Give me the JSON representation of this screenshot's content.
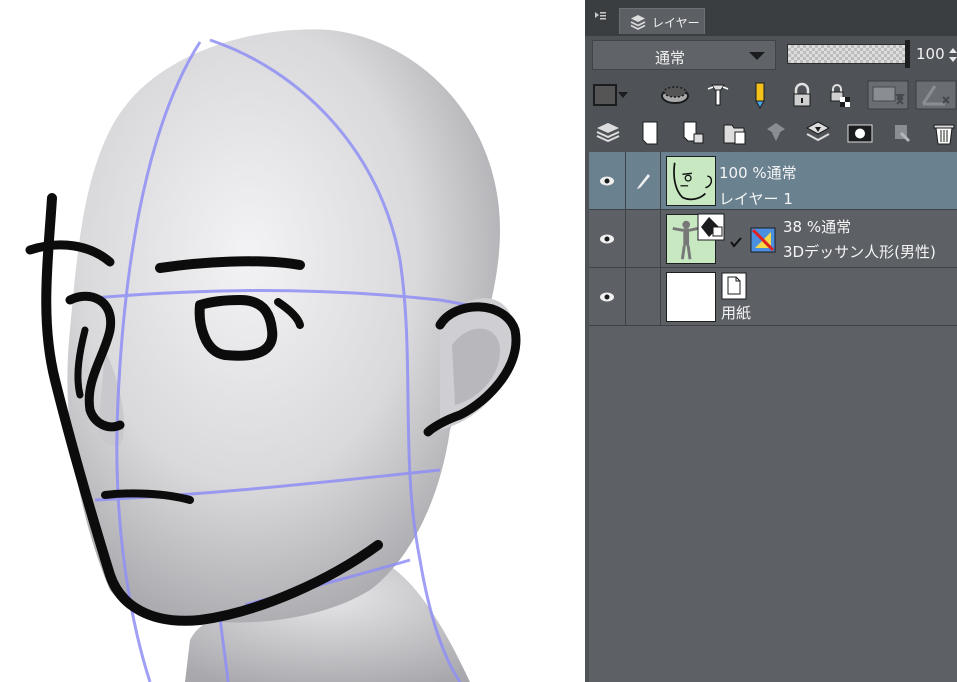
{
  "panel": {
    "tab_label": "レイヤー",
    "blend_mode": "通常",
    "opacity_value": "100",
    "opacity_fraction": 1.0
  },
  "toolbar_row1": [
    "color-mode-icon",
    "clip-icon",
    "reference-layer-icon",
    "draft-layer-icon",
    "lock-icon",
    "lock-transparent-icon",
    "mask-disable-icon",
    "ruler-disable-icon"
  ],
  "toolbar_row2": [
    "layer-property-icon",
    "new-raster-layer-icon",
    "new-vector-layer-icon",
    "new-folder-icon",
    "transfer-down-icon",
    "merge-down-icon",
    "layer-mask-icon",
    "apply-mask-icon",
    "delete-layer-icon"
  ],
  "layers": [
    {
      "opacity": "100 %",
      "mode": "通常",
      "name": "レイヤー 1",
      "selected": true,
      "visible": true,
      "editing": true,
      "type": "raster"
    },
    {
      "opacity": "38 %",
      "mode": "通常",
      "name": "3Dデッサン人形(男性)",
      "selected": false,
      "visible": true,
      "editing": false,
      "type": "3d"
    },
    {
      "opacity": "",
      "mode": "",
      "name": "用紙",
      "selected": false,
      "visible": true,
      "editing": false,
      "type": "paper"
    }
  ],
  "colors": {
    "panel_bg": "#4f5357",
    "list_bg": "#5d6166",
    "selected_row": "#6a8190",
    "guide_line": "#8f8ff5",
    "thumb_green": "#c7e8c1"
  }
}
